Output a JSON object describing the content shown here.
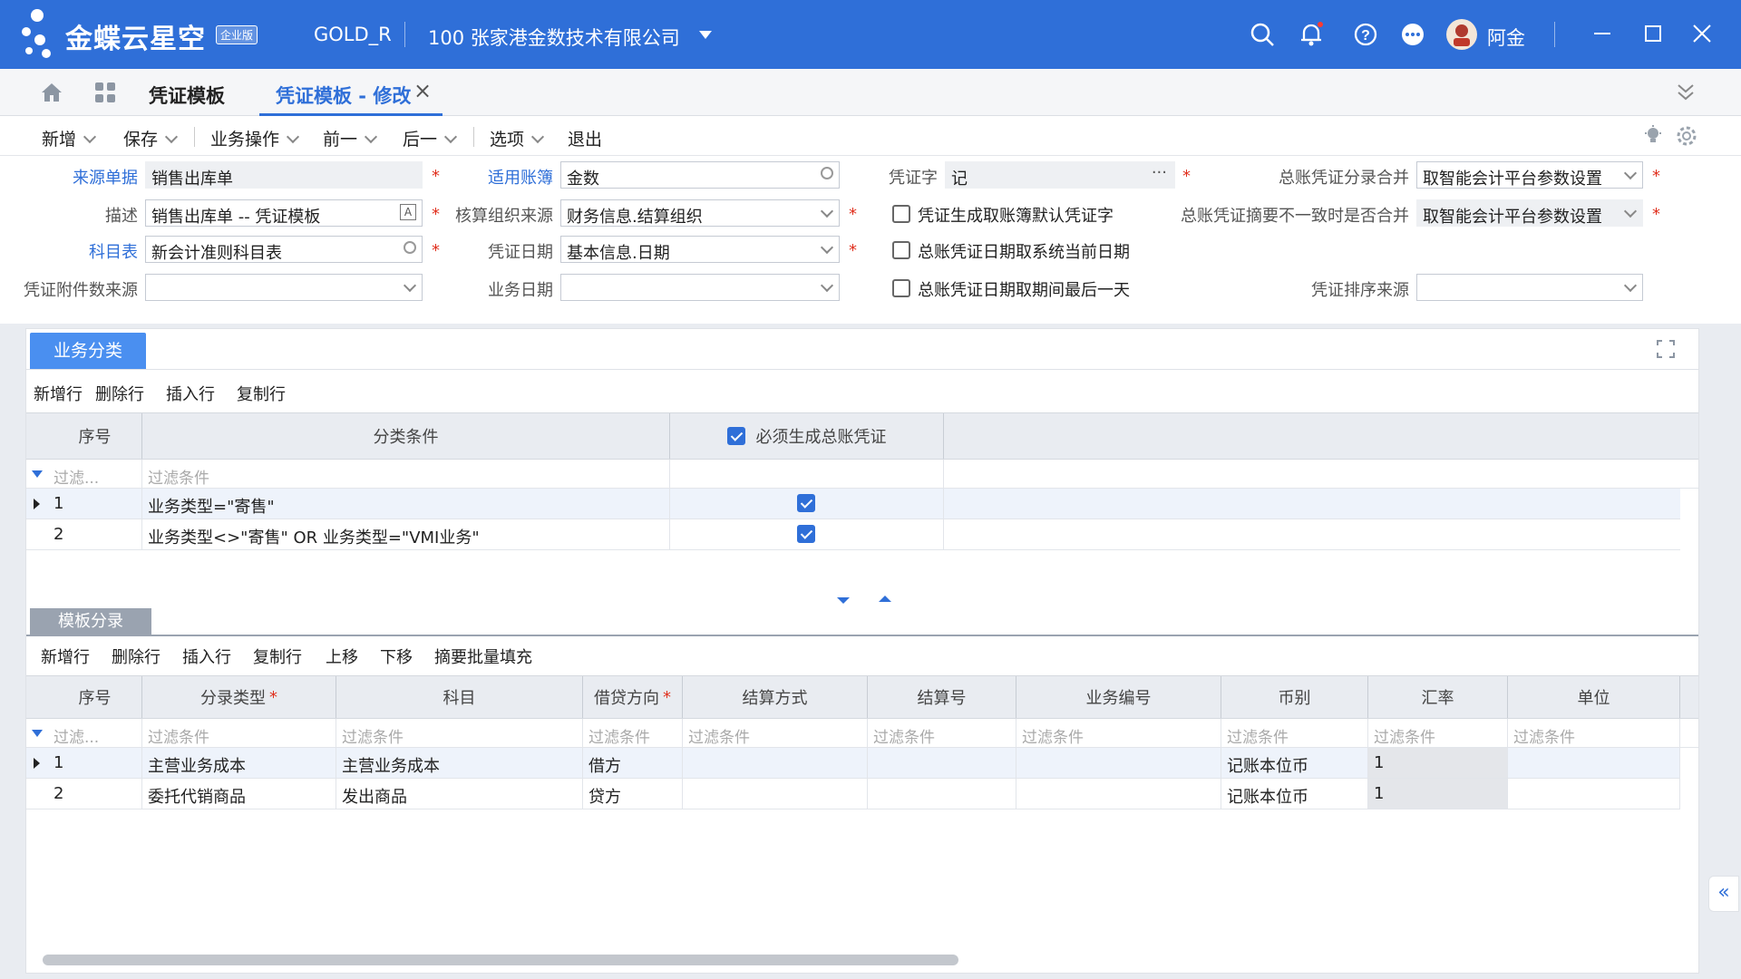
{
  "app": {
    "brand": "金蝶云星空",
    "edition": "企业版",
    "database": "GOLD_R",
    "company": "100  张家港金数技术有限公司",
    "user": "阿金"
  },
  "tabs": {
    "parent": "凭证模板",
    "active": "凭证模板 - 修改"
  },
  "toolbar": {
    "new": "新增",
    "save": "保存",
    "business_ops": "业务操作",
    "prev": "前一",
    "next": "后一",
    "options": "选项",
    "exit": "退出"
  },
  "form": {
    "source_doc_label": "来源单据",
    "source_doc_value": "销售出库单",
    "ledger_label": "适用账簿",
    "ledger_value": "金数",
    "voucher_word_label": "凭证字",
    "voucher_word_value": "记",
    "gl_merge_label": "总账凭证分录合并",
    "gl_merge_value": "取智能会计平台参数设置",
    "desc_label": "描述",
    "desc_value": "销售出库单 -- 凭证模板",
    "org_source_label": "核算组织来源",
    "org_source_value": "财务信息.结算组织",
    "cb_default_word": "凭证生成取账簿默认凭证字",
    "summary_merge_label": "总账凭证摘要不一致时是否合并",
    "summary_merge_value": "取智能会计平台参数设置",
    "account_table_label": "科目表",
    "account_table_value": "新会计准则科目表",
    "voucher_date_label": "凭证日期",
    "voucher_date_value": "基本信息.日期",
    "cb_current_date": "总账凭证日期取系统当前日期",
    "attach_source_label": "凭证附件数来源",
    "attach_source_value": "",
    "biz_date_label": "业务日期",
    "biz_date_value": "",
    "cb_period_last": "总账凭证日期取期间最后一天",
    "sort_source_label": "凭证排序来源",
    "sort_source_value": ""
  },
  "section1": {
    "tab": "业务分类",
    "tools": [
      "新增行",
      "删除行",
      "插入行",
      "复制行"
    ],
    "headers": {
      "seq": "序号",
      "condition": "分类条件",
      "must_gen": "必须生成总账凭证"
    },
    "filter_seq": "过滤...",
    "filter_cond": "过滤条件",
    "rows": [
      {
        "seq": "1",
        "condition": "业务类型=\"寄售\"",
        "checked": true
      },
      {
        "seq": "2",
        "condition": "业务类型<>\"寄售\"  OR 业务类型=\"VMI业务\"",
        "checked": true
      }
    ]
  },
  "section2": {
    "tab": "模板分录",
    "tools": [
      "新增行",
      "删除行",
      "插入行",
      "复制行",
      "上移",
      "下移",
      "摘要批量填充"
    ],
    "headers": [
      "序号",
      "分录类型",
      "科目",
      "借贷方向",
      "结算方式",
      "结算号",
      "业务编号",
      "币别",
      "汇率",
      "单位"
    ],
    "filter_seq": "过滤...",
    "filter_text": "过滤条件",
    "rows": [
      {
        "seq": "1",
        "type": "主营业务成本",
        "account": "主营业务成本",
        "direction": "借方",
        "settle": "",
        "settle_no": "",
        "biz_no": "",
        "currency": "记账本位币",
        "rate": "1",
        "unit": ""
      },
      {
        "seq": "2",
        "type": "委托代销商品",
        "account": "发出商品",
        "direction": "贷方",
        "settle": "",
        "settle_no": "",
        "biz_no": "",
        "currency": "记账本位币",
        "rate": "1",
        "unit": ""
      }
    ]
  },
  "colors": {
    "primary": "#2f6fd8",
    "required": "#e0301e",
    "header_bg": "#e9ecf1"
  }
}
